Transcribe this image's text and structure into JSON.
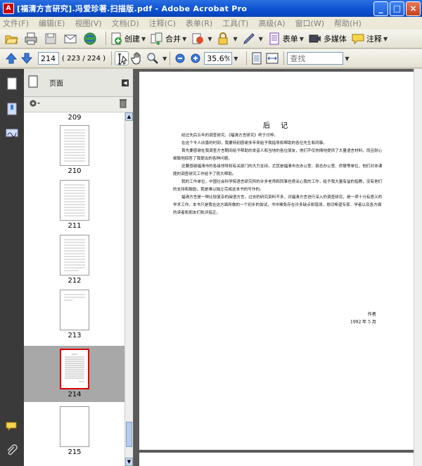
{
  "window": {
    "title": "[福清方言研究].冯爱珍著.扫描版.pdf - Adobe Acrobat Pro",
    "app_icon": "acrobat-icon",
    "minimize": "_",
    "maximize": "□",
    "close": "×"
  },
  "menu": [
    "文件(F)",
    "编辑(E)",
    "视图(V)",
    "文档(D)",
    "注释(C)",
    "表单(R)",
    "工具(T)",
    "高级(A)",
    "窗口(W)",
    "帮助(H)"
  ],
  "toolbar": {
    "create": "创建",
    "combine": "合并",
    "forms": "表单",
    "multimedia": "多媒体",
    "comment": "注释"
  },
  "nav": {
    "current_page": "214",
    "page_count": "( 223 / 224 )",
    "zoom": "35.6%",
    "find_placeholder": "查找"
  },
  "panel": {
    "title": "页面",
    "options_icon": "gear-icon",
    "delete_icon": "trash-icon"
  },
  "thumbnails": [
    {
      "label": "209"
    },
    {
      "label": "210"
    },
    {
      "label": "211"
    },
    {
      "label": "212"
    },
    {
      "label": "213"
    },
    {
      "label": "214",
      "selected": true
    },
    {
      "label": "215"
    }
  ],
  "document": {
    "heading": "后 记",
    "paragraphs": [
      "经过先后五年的调查研究，《福清方言研究》终于付梓。",
      "在这个令人欣喜的时刻，我要特别感谢多年来给予我指导和帮助的各位先生和同事。",
      "首先要感谢在我调查方言期间给予帮助的发音人和当地的各位朋友，他们不仅热情地提供了大量语言材料，而且耐心细致地回答了我提出的各种问题。",
      "还要感谢福清市的各级领导和有关部门的大力支持，尤其是福清市志办公室、县志办公室、侨联等单位，他们对本课题的调查研究工作给予了很大帮助。",
      "我的工作单位，中国社会科学院语言研究所的许多老师和同事也很关心我的工作，给予我大量有益的指教，没有他们的支持和鼓励，我是难以独立完成这本书的写作的。",
      "福清方言是一种比较复杂的闽语方言，过去的研究资料不多，对福清方言进行深入的调查研究，是一项十分有意义的学术工作。本书只是我在这方面所做的一个初步的尝试，书中难免存在许多缺点和错误，恳切希望专家、学者以及各方面的读者和朋友们批评指正。"
    ],
    "author": "作者",
    "date": "1992 年 5 月"
  },
  "icons": {
    "open": "folder-open-icon",
    "print": "printer-icon",
    "save": "save-icon",
    "email": "email-icon",
    "web": "globe-icon",
    "create": "create-pdf-icon",
    "combine": "combine-icon",
    "export": "export-icon",
    "secure": "lock-icon",
    "sign": "pen-icon",
    "forms": "form-icon",
    "multimedia": "multimedia-icon",
    "comment": "comment-icon",
    "prev": "arrow-up-icon",
    "next": "arrow-down-icon",
    "select": "select-text-icon",
    "hand": "hand-icon",
    "zoom_tool": "zoom-tool-icon",
    "zoom_out": "zoom-out-icon",
    "zoom_in": "zoom-in-icon",
    "fit_page": "fit-page-icon",
    "fit_width": "fit-width-icon"
  }
}
